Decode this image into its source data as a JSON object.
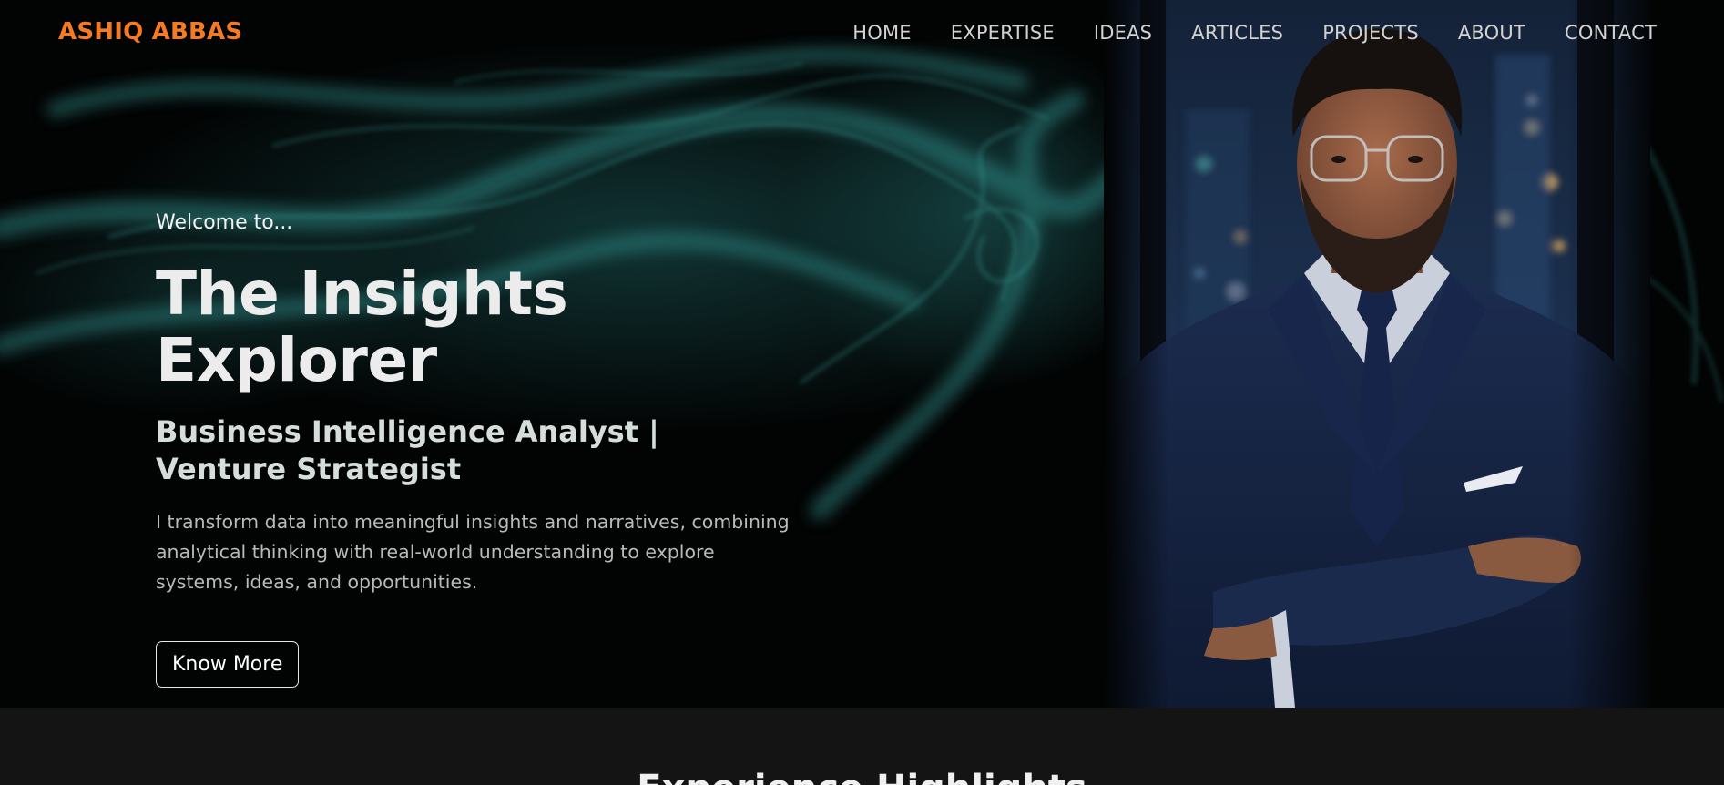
{
  "brand": {
    "logo_text": "ASHIQ ABBAS",
    "accent_color": "#f47a24"
  },
  "nav": {
    "items": [
      {
        "label": "HOME"
      },
      {
        "label": "EXPERTISE"
      },
      {
        "label": "IDEAS"
      },
      {
        "label": "ARTICLES"
      },
      {
        "label": "PROJECTS"
      },
      {
        "label": "ABOUT"
      },
      {
        "label": "CONTACT"
      }
    ]
  },
  "hero": {
    "welcome": "Welcome to...",
    "title": "The Insights Explorer",
    "subtitle": "Business Intelligence Analyst | Venture Strategist",
    "description": "I transform data into meaningful insights and narratives, combining analytical thinking with real-world understanding to explore systems, ideas, and opportunities.",
    "cta_label": "Know More",
    "background_color": "#020303",
    "smoke_color": "#1f6b6a"
  },
  "highlights": {
    "title": "Experience Highlights",
    "background_color": "#141414"
  }
}
